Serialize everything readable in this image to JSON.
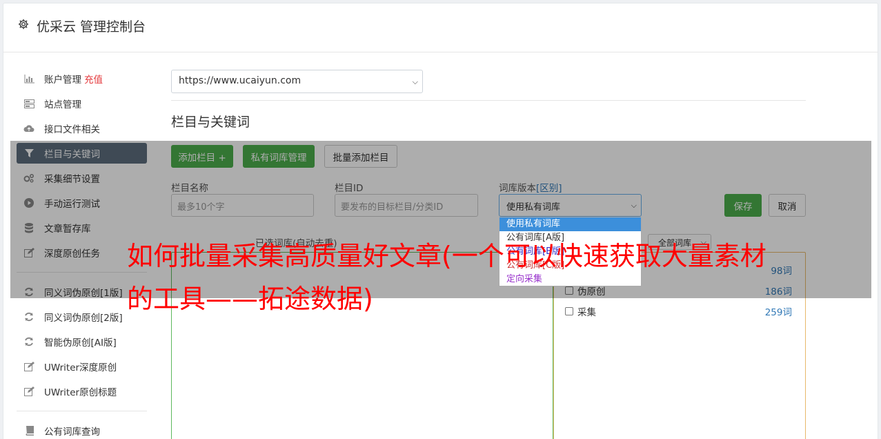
{
  "header": {
    "title": "优采云 管理控制台",
    "icon": "gear-icon"
  },
  "sidebar": {
    "items": [
      {
        "label": "账户管理",
        "extra": "充值",
        "icon": "bar-chart-icon"
      },
      {
        "label": "站点管理",
        "icon": "server-icon"
      },
      {
        "label": "接口文件相关",
        "icon": "cloud-upload-icon"
      },
      {
        "label": "栏目与关键词",
        "icon": "filter-icon",
        "active": true
      },
      {
        "label": "采集细节设置",
        "icon": "cogs-icon"
      },
      {
        "label": "手动运行测试",
        "icon": "play-circle-icon"
      },
      {
        "label": "文章暂存库",
        "icon": "database-icon"
      },
      {
        "label": "深度原创任务",
        "icon": "edit-icon"
      },
      {
        "label": "同义词伪原创[1版]",
        "icon": "refresh-icon"
      },
      {
        "label": "同义词伪原创[2版]",
        "icon": "refresh-icon"
      },
      {
        "label": "智能伪原创[AI版]",
        "icon": "refresh-icon"
      },
      {
        "label": "UWriter深度原创",
        "icon": "edit-icon"
      },
      {
        "label": "UWriter原创标题",
        "icon": "edit-icon"
      },
      {
        "label": "公有词库查询",
        "icon": "book-icon"
      }
    ]
  },
  "main": {
    "site_select": "https://www.ucaiyun.com",
    "section_title": "栏目与关键词",
    "buttons": {
      "add_column": "添加栏目 +",
      "private_lib": "私有词库管理",
      "batch_add": "批量添加栏目",
      "save": "保存",
      "cancel": "取消"
    },
    "form": {
      "column_name_label": "栏目名称",
      "column_name_placeholder": "最多10个字",
      "column_id_label": "栏目ID",
      "column_id_placeholder": "要发布的目标栏目/分类ID",
      "lib_version_label": "词库版本",
      "lib_version_link": "[区别]",
      "lib_version_value": "使用私有词库"
    },
    "dropdown_options": [
      {
        "label": "使用私有词库",
        "color": "#ffffff"
      },
      {
        "label": "公有词库[A版]",
        "color": "#333333"
      },
      {
        "label": "公有词库[B版]",
        "color": "#3333cc"
      },
      {
        "label": "公有词库[C版]",
        "color": "#cc3333"
      },
      {
        "label": "定向采集",
        "color": "#9933cc"
      }
    ],
    "selected_words_label": "已选词库(自动去重)",
    "all_libs_select": "全部词库",
    "libs": [
      {
        "name": "",
        "count": "98词"
      },
      {
        "name": "伪原创",
        "count": "186词"
      },
      {
        "name": "采集",
        "count": "259词"
      }
    ]
  },
  "overlay_caption": "如何批量采集高质量好文章(一个可以快速获取大量素材的工具——拓途数据)"
}
